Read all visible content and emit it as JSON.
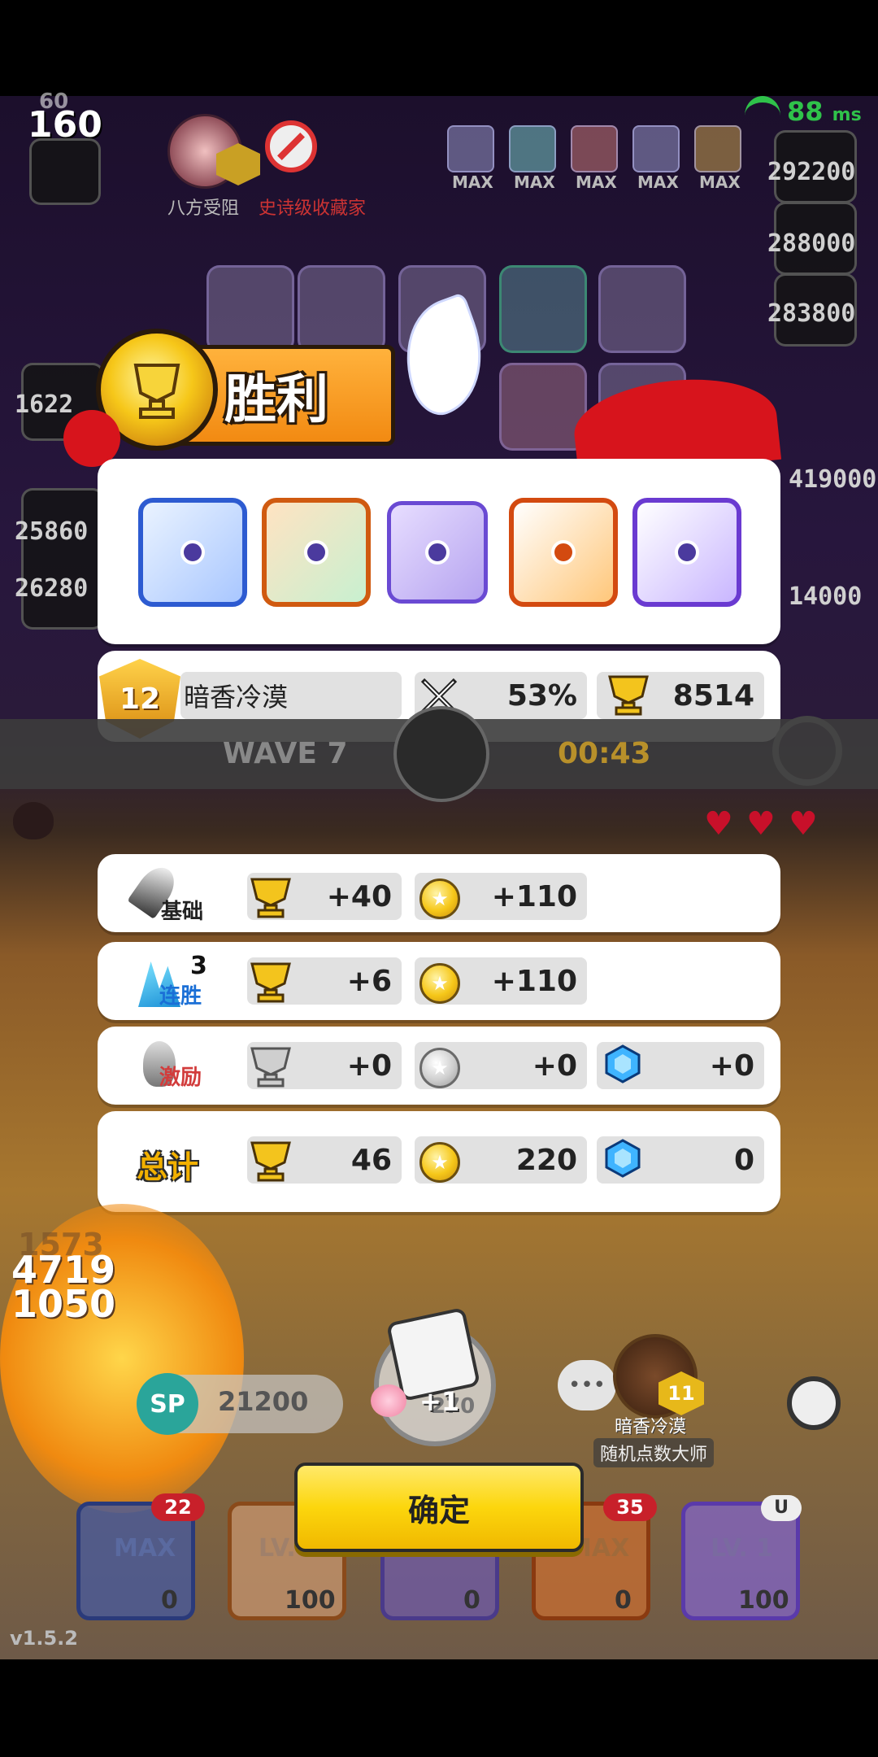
{
  "hud": {
    "wave_top": "60",
    "wave_big": "160",
    "player1_name": "八方受阻",
    "player2_name": "史诗级收藏家",
    "ping": "88",
    "ping_unit": "ms",
    "max_label": "MAX",
    "scores_right": [
      "292200",
      "288000",
      "283800",
      "419000",
      "14000"
    ],
    "scores_left": [
      "1622",
      "25860",
      "26280"
    ],
    "wave_label": "WAVE 7",
    "timer": "00:43",
    "damage_top": "1573",
    "damage_a": "4719",
    "damage_b": "1050",
    "sp_label": "SP",
    "sp_value": "21200",
    "peach_bonus": "+1",
    "dice_cost": "270",
    "opponent_name": "暗香冷漠",
    "opponent_title": "随机点数大师",
    "opponent_level": "11",
    "opponent_rank": "12",
    "version": "v1.5.2",
    "slots": [
      {
        "badge": "22",
        "label": "MAX",
        "sp": "0"
      },
      {
        "badge": "",
        "label": "LV.",
        "sp": "100"
      },
      {
        "badge": "",
        "label": "",
        "sp": "0"
      },
      {
        "badge": "35",
        "label": "MAX",
        "sp": "0"
      },
      {
        "badge": "U",
        "label": "LV. 1",
        "sp": "100"
      }
    ]
  },
  "victory": {
    "title": "胜利"
  },
  "result": {
    "player_rank": "12",
    "player_name": "暗香冷漠",
    "win_rate": "53%",
    "trophies": "8514"
  },
  "rewards": {
    "rows": [
      {
        "label": "基础",
        "trophy": "+40",
        "coin": "+110",
        "gem": ""
      },
      {
        "label": "连胜",
        "streak": "3",
        "trophy": "+6",
        "coin": "+110",
        "gem": ""
      },
      {
        "label": "激励",
        "trophy": "+0",
        "coin": "+0",
        "gem": "+0"
      }
    ],
    "total": {
      "label": "总计",
      "trophy": "46",
      "coin": "220",
      "gem": "0"
    }
  },
  "confirm_label": "确定",
  "colors": {
    "accent": "#fcd60d",
    "banner": "#f28a12",
    "gold": "#e7b81a"
  }
}
